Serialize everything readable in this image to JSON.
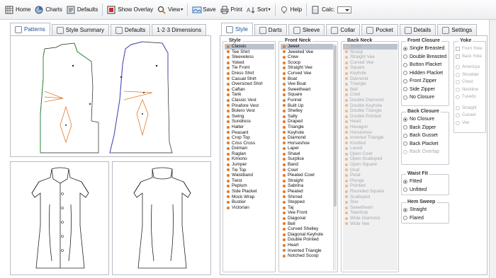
{
  "toolbar": {
    "home": "Home",
    "charts": "Charts",
    "defaults": "Defaults",
    "show_overlay": "Show Overlay",
    "view": "View",
    "save": "Save",
    "print": "Print",
    "sort": "Sort",
    "help": "Help",
    "calc": "Calc:"
  },
  "left_tabs": [
    "Patterns",
    "Style Summary",
    "Defaults",
    "1·2·3 Dimensions"
  ],
  "right_tabs": [
    "Style",
    "Darts",
    "Sleeve",
    "Collar",
    "Pocket",
    "Details",
    "Settings"
  ],
  "style": {
    "title": "Style",
    "items": [
      "Classic",
      "Tee Shirt",
      "Sleeveless",
      "Yoked",
      "Tie Front",
      "Dress Shirt",
      "Casual Shirt",
      "Oversized Shirt",
      "Caftan",
      "Tank",
      "Classic Vest",
      "Pinafore Vest",
      "Bolero Vest",
      "Swing",
      "Sundress",
      "Halter",
      "Peasant",
      "Crop Top",
      "Criss Cross",
      "Dolman",
      "Raglan",
      "Kimono",
      "Jumper",
      "Tie Top",
      "Waistband",
      "Twist",
      "Peplum",
      "Side Placket",
      "Mock Wrap",
      "Bustier",
      "Victorian"
    ],
    "selected": 0
  },
  "front_neck": {
    "title": "Front Neck",
    "items": [
      "Jewel",
      "Jeweled Vee",
      "Crew",
      "Scoop",
      "Straight Vee",
      "Curved Vee",
      "Boat",
      "Vee Boat",
      "Sweetheart",
      "Square",
      "Funnel",
      "Built Up",
      "Shelley",
      "Sally",
      "Draped",
      "Triangle",
      "Keyhole",
      "Diamond",
      "Horseshoe",
      "Lapel",
      "Shawl",
      "Surplice",
      "Band",
      "Cowl",
      "Pleated Cowl",
      "Straight",
      "Sabrina",
      "Pleated",
      "Shirred",
      "Stepped",
      "Taj",
      "Vee Front",
      "Diagonal",
      "Bell",
      "Curved Shelley",
      "Diagonal Keyhole",
      "Double Pointed",
      "Heart",
      "Inverted Triangle",
      "Notched Scoop"
    ],
    "selected": 0
  },
  "back_neck": {
    "title": "Back Neck",
    "items": [
      "Jewel",
      "Scoop",
      "Straight Vee",
      "Curved Vee",
      "Square",
      "Keyhole",
      "Diamond",
      "Triangle",
      "Bell",
      "Cowl",
      "Double Diamond",
      "Double Keyhole",
      "Double Triangle",
      "Double Pointed",
      "Heart",
      "Hexagon",
      "Horseshoe",
      "Inverted Triangle",
      "Knotted",
      "Laced",
      "Open Cowl",
      "Open Scalloped",
      "Open Square",
      "Oval",
      "Petal",
      "Plunge",
      "Pointed",
      "Rounded Square",
      "Scalloped",
      "Star",
      "Sweetheart",
      "Teardrop",
      "Wide Diamond",
      "Wide Vee"
    ],
    "selected": 0
  },
  "front_closure": {
    "title": "Front Closure",
    "options": [
      "Single Breasted",
      "Double Breasted",
      "Button Placket",
      "Hidden Placket",
      "Front Zipper",
      "Side Zipper",
      "No Closure"
    ],
    "selected": 0
  },
  "back_closure": {
    "title": "Back Closure",
    "options": [
      "No Closure",
      "Back Zipper",
      "Back Gusset",
      "Back Placket",
      "Back Overlap"
    ],
    "selected": 0,
    "disabled": [
      4
    ]
  },
  "waist_fit": {
    "title": "Waist Fit",
    "options": [
      "Fitted",
      "Unfitted"
    ],
    "selected": 0
  },
  "hem_sweep": {
    "title": "Hem Sweep",
    "options": [
      "Straight",
      "Flared"
    ],
    "selected": 0
  },
  "yoke": {
    "title": "Yoke",
    "checks": [
      "Front Yoke",
      "Back Yoke"
    ],
    "radios1": [
      "Americya",
      "Shoulder",
      "Chest",
      "Neckline",
      "Tuxedo"
    ],
    "radios2": [
      "Straight",
      "Curved",
      "Vee"
    ]
  },
  "colors": {
    "accent": "#1d4f9b",
    "dot": "#e07a2c",
    "front_outline": "#2e8b3a",
    "back_outline": "#4545b8",
    "darts": "#e07a2c"
  }
}
